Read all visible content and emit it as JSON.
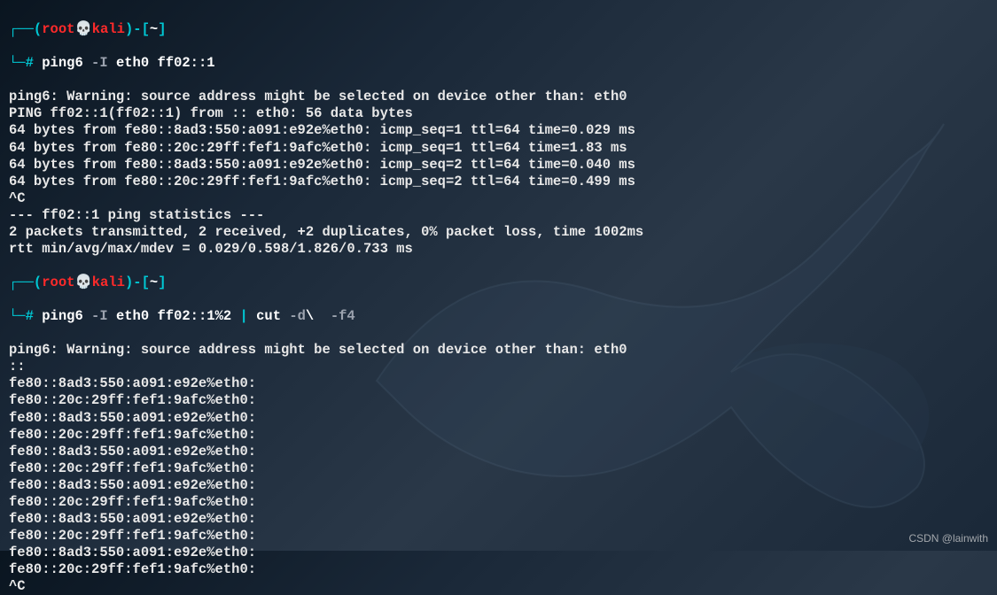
{
  "prompt1": {
    "corner_tl": "┌──(",
    "user": "root",
    "skull": "💀",
    "host": "kali",
    "close_paren": ")",
    "dash": "-[",
    "path": "~",
    "close_bracket": "]",
    "corner_bl": "└─",
    "hash": "#"
  },
  "cmd1": {
    "base": "ping6",
    "flag": " -I",
    "args": " eth0 ff02::1"
  },
  "output1": {
    "line1": "ping6: Warning: source address might be selected on device other than: eth0",
    "line2": "PING ff02::1(ff02::1) from :: eth0: 56 data bytes",
    "line3": "64 bytes from fe80::8ad3:550:a091:e92e%eth0: icmp_seq=1 ttl=64 time=0.029 ms",
    "line4": "64 bytes from fe80::20c:29ff:fef1:9afc%eth0: icmp_seq=1 ttl=64 time=1.83 ms",
    "line5": "64 bytes from fe80::8ad3:550:a091:e92e%eth0: icmp_seq=2 ttl=64 time=0.040 ms",
    "line6": "64 bytes from fe80::20c:29ff:fef1:9afc%eth0: icmp_seq=2 ttl=64 time=0.499 ms",
    "line7": "^C",
    "line8": "--- ff02::1 ping statistics ---",
    "line9": "2 packets transmitted, 2 received, +2 duplicates, 0% packet loss, time 1002ms",
    "line10": "rtt min/avg/max/mdev = 0.029/0.598/1.826/0.733 ms"
  },
  "cmd2": {
    "base": "ping6",
    "flag1": " -I",
    "args1": " eth0 ff02::1%2 ",
    "pipe": "|",
    "cut": " cut",
    "flag2": " -d",
    "backslash": "\\ ",
    "flag3": " -f4"
  },
  "output2": {
    "line1": "ping6: Warning: source address might be selected on device other than: eth0",
    "line2": "::",
    "line3": "fe80::8ad3:550:a091:e92e%eth0:",
    "line4": "fe80::20c:29ff:fef1:9afc%eth0:",
    "line5": "fe80::8ad3:550:a091:e92e%eth0:",
    "line6": "fe80::20c:29ff:fef1:9afc%eth0:",
    "line7": "fe80::8ad3:550:a091:e92e%eth0:",
    "line8": "fe80::20c:29ff:fef1:9afc%eth0:",
    "line9": "fe80::8ad3:550:a091:e92e%eth0:",
    "line10": "fe80::20c:29ff:fef1:9afc%eth0:",
    "line11": "fe80::8ad3:550:a091:e92e%eth0:",
    "line12": "fe80::20c:29ff:fef1:9afc%eth0:",
    "line13": "fe80::8ad3:550:a091:e92e%eth0:",
    "line14": "fe80::20c:29ff:fef1:9afc%eth0:",
    "line15": "^C"
  },
  "watermark": "CSDN @lainwith"
}
